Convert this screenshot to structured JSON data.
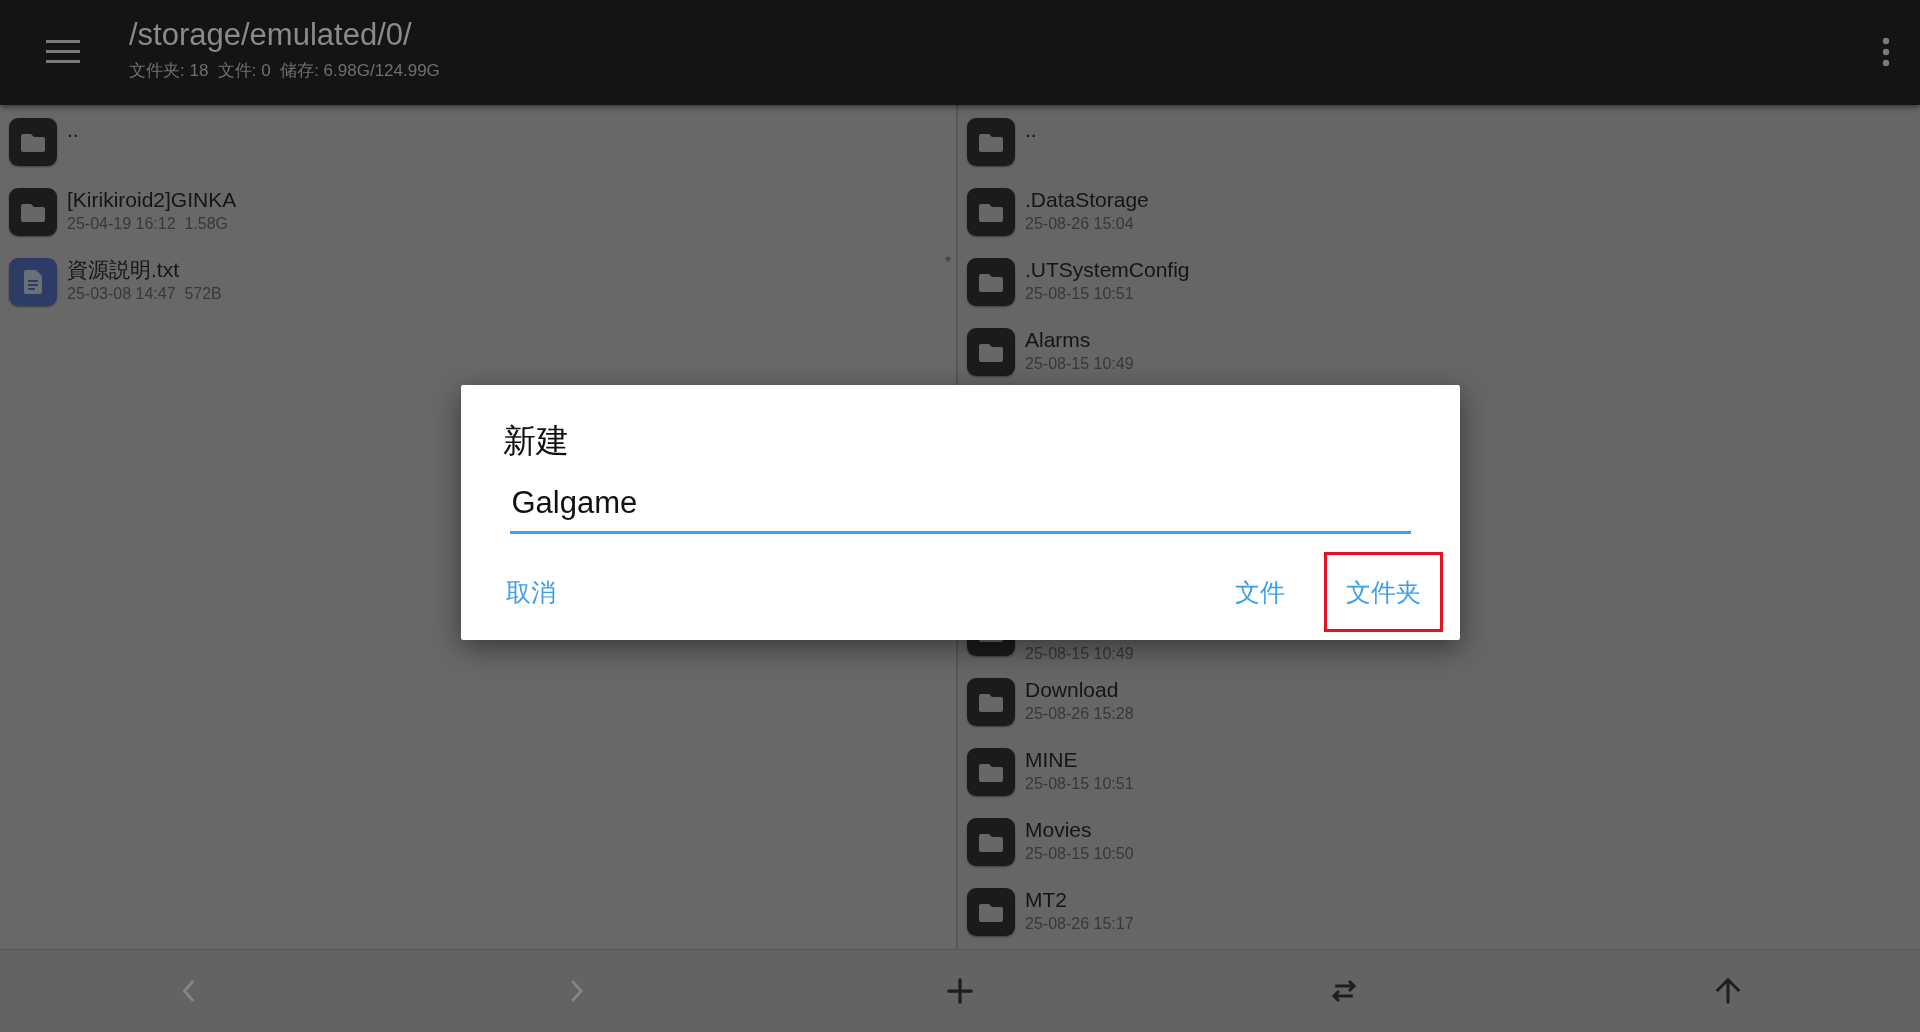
{
  "app_bar": {
    "path": "/storage/emulated/0/",
    "summary": "文件夹: 18  文件: 0  储存: 6.98G/124.99G"
  },
  "left_pane": {
    "items": [
      {
        "kind": "folder",
        "name": ".."
      },
      {
        "kind": "folder",
        "name": "[Kirikiroid2]GINKA",
        "details": "25-04-19 16:12  1.58G"
      },
      {
        "kind": "text-file",
        "name": "資源説明.txt",
        "details": "25-03-08 14:47  572B",
        "marker": "*"
      }
    ]
  },
  "right_pane": {
    "items": [
      {
        "kind": "folder",
        "name": ".."
      },
      {
        "kind": "folder",
        "name": ".DataStorage",
        "details": "25-08-26 15:04"
      },
      {
        "kind": "folder",
        "name": ".UTSystemConfig",
        "details": "25-08-15 10:51"
      },
      {
        "kind": "folder",
        "name": "Alarms",
        "details": "25-08-15 10:49"
      },
      {
        "kind": "folder",
        "details": "25-08-15 10:49",
        "covered": true
      },
      {
        "kind": "folder",
        "name": "Download",
        "details": "25-08-26 15:28"
      },
      {
        "kind": "folder",
        "name": "MINE",
        "details": "25-08-15 10:51"
      },
      {
        "kind": "folder",
        "name": "Movies",
        "details": "25-08-15 10:50"
      },
      {
        "kind": "folder",
        "name": "MT2",
        "details": "25-08-26 15:17"
      }
    ]
  },
  "bottom_bar": {
    "buttons": [
      {
        "kind": "back",
        "disabled": true
      },
      {
        "kind": "forward",
        "disabled": true
      },
      {
        "kind": "add",
        "disabled": false
      },
      {
        "kind": "swap",
        "disabled": false
      },
      {
        "kind": "up",
        "disabled": false
      }
    ]
  },
  "dialog": {
    "title": "新建",
    "value": "Galgame",
    "buttons": [
      {
        "label": "取消",
        "kind": "dismiss",
        "highlighted": false
      },
      {
        "label": "文件",
        "kind": "confirm",
        "highlighted": false
      },
      {
        "label": "文件夹",
        "kind": "confirm",
        "highlighted": true
      }
    ]
  }
}
